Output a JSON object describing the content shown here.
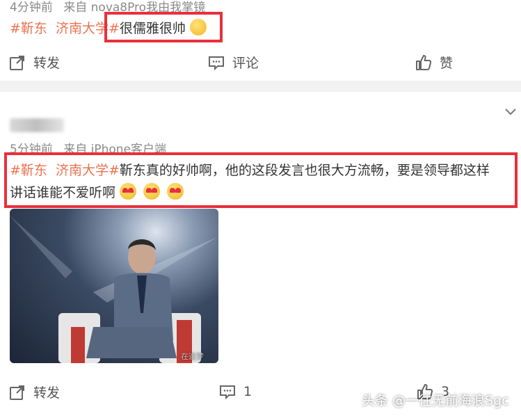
{
  "post1": {
    "meta_time": "4分钟前",
    "meta_source": "来自 nova8Pro我由我掌镜",
    "tag1": "#靳东",
    "tag2": "济南大学#",
    "comment": "很儒雅很帅"
  },
  "actions1": {
    "repost": "转发",
    "comment": "评论",
    "like": "赞"
  },
  "post2": {
    "meta_time": "5分钟前",
    "meta_source": "来自 iPhone客户端",
    "tag1": "#靳东",
    "tag2": "济南大学#",
    "line1": "靳东真的好帅啊，他的这段发言也很大方流畅，要是领导都这样",
    "line2": "讲话谁能不爱听啊",
    "photo_watermark": "在追梦"
  },
  "actions2": {
    "repost": "转发",
    "comment_count": "1",
    "like_count": "3"
  },
  "watermark": "头条 @一往无前海浪Sgc",
  "colors": {
    "tag": "#eb7350",
    "highlight": "#e8303a",
    "meta": "#8a8a8a"
  }
}
